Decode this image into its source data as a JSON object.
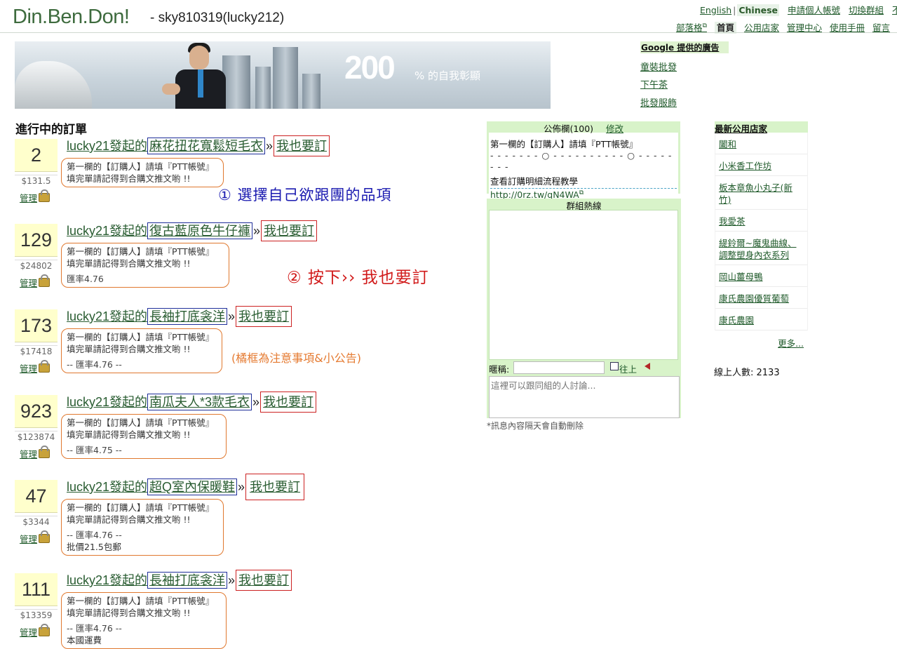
{
  "header": {
    "logo": "Din.Ben.Don!",
    "user": "- sky810319(lucky212)",
    "top_links": {
      "english": "English",
      "sep": "|",
      "chinese": "Chinese",
      "apply": "申請個人帳號",
      "switch_group": "切換群組",
      "extra": "不"
    },
    "nav": {
      "blog": "部落格",
      "home": "首頁",
      "stores": "公用店家",
      "admin": "管理中心",
      "manual": "使用手冊",
      "guestbook": "留言"
    }
  },
  "banner": {
    "big": "200",
    "small": "% 的自我彰顯"
  },
  "ads": {
    "title": "Google 提供的廣告",
    "links": [
      "童裝批發",
      "下午茶",
      "批發服飾"
    ]
  },
  "orders_heading": "進行中的訂單",
  "orders": [
    {
      "count": "2",
      "amount": "$131.5",
      "manage": "管理",
      "starter": "lucky21發起的",
      "item": "麻花扭花寬鬆短毛衣",
      "raquo": "»",
      "join": "我也要訂",
      "note": [
        "第一欄的【訂購人】請填『PTT帳號』",
        "填完單請記得到合購文推文喲 !!"
      ]
    },
    {
      "count": "129",
      "amount": "$24802",
      "manage": "管理",
      "starter": "lucky21發起的",
      "item": "復古藍原色牛仔褲",
      "raquo": "»",
      "join": "我也要訂",
      "note": [
        "第一欄的【訂購人】請填『PTT帳號』",
        "填完單請記得到合購文推文喲 !!"
      ],
      "rate": "匯率4.76"
    },
    {
      "count": "173",
      "amount": "$17418",
      "manage": "管理",
      "starter": "lucky21發起的",
      "item": "長袖打底衾洋",
      "raquo": "»",
      "join": "我也要訂",
      "note": [
        "第一欄的【訂購人】請填『PTT帳號』",
        "填完單請記得到合購文推文喲 !!"
      ],
      "rate": "-- 匯率4.76 --"
    },
    {
      "count": "923",
      "amount": "$123874",
      "manage": "管理",
      "starter": "lucky21發起的",
      "item": "南瓜夫人*3款毛衣",
      "raquo": "»",
      "join": "我也要訂",
      "note": [
        "第一欄的【訂購人】請填『PTT帳號』",
        "填完單請記得到合購文推文喲 !!"
      ],
      "rate": "-- 匯率4.75 --"
    },
    {
      "count": "47",
      "amount": "$3344",
      "manage": "管理",
      "starter": "lucky21發起的",
      "item": "超Q室內保暖鞋",
      "raquo": "»",
      "join": "我也要訂",
      "note": [
        "第一欄的【訂購人】請填『PTT帳號』",
        "填完單請記得到合購文推文喲 !!"
      ],
      "rate": "-- 匯率4.76 --",
      "extra": "批價21.5包郵"
    },
    {
      "count": "111",
      "amount": "$13359",
      "manage": "管理",
      "starter": "lucky21發起的",
      "item": "長袖打底衾洋",
      "raquo": "»",
      "join": "我也要訂",
      "note": [
        "第一欄的【訂購人】請填『PTT帳號』",
        "填完單請記得到合購文推文喲 !!"
      ],
      "rate": "-- 匯率4.76 --",
      "extra": "本國運費"
    }
  ],
  "annotations": {
    "step1": "① 選擇自己欲跟團的品項",
    "step2": "② 按下›› 我也要訂",
    "note": "(橘框為注意事項&小公告)"
  },
  "bulletin": {
    "title": "公佈欄(100)",
    "edit": "修改",
    "line1": "第一欄的【訂購人】請填『PTT帳號』",
    "dots": "- - - - - - - ○ - - - - - - - - - - ○ - - - - - - - -",
    "line2": "查看訂購明細流程教學",
    "url": "http://0rz.tw/qN4WA"
  },
  "chat": {
    "title": "群組熱線",
    "nick_label": "暱稱:",
    "up_label": "往上",
    "placeholder": "這裡可以跟同組的人討論...",
    "footer": "*訊息內容隔天會自動刪除"
  },
  "stores": {
    "title": "最新公用店家",
    "items": [
      "闔和",
      "小米香工作坊",
      "板本章魚小丸子(新竹)",
      "我愛茶",
      "緹鈴爾~魔鬼曲線、調整塑身內衣系列",
      "岡山薑母鴨",
      "康氏農園優質葡萄",
      "康氏農園"
    ],
    "more": "更多..."
  },
  "online": "線上人數: 2133",
  "colors": {
    "green_bar": "#d8f3c9",
    "link_green": "#1f5a2a",
    "count_bg": "#ffffcc",
    "item_border": "#1f2f9a",
    "join_border": "#cc2222",
    "note_border": "#e0782e"
  }
}
